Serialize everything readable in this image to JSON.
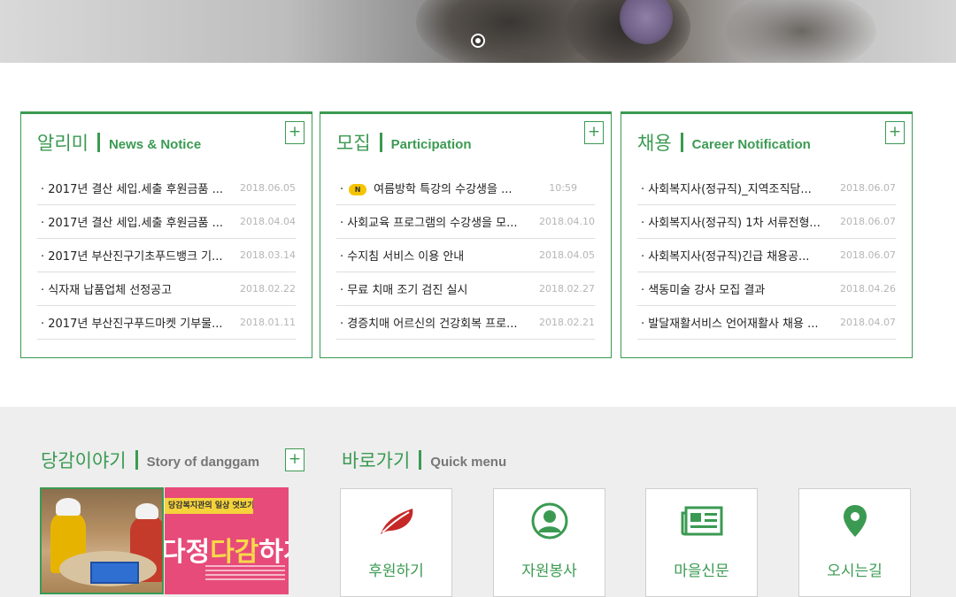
{
  "notice": {
    "title": "알리미",
    "subtitle": "News & Notice",
    "more": "+",
    "items": [
      {
        "title": "2017년 결산 세입.세출 후원금품 ...",
        "date": "2018.06.05"
      },
      {
        "title": "2017년 결산 세입.세출 후원금품 ...",
        "date": "2018.04.04"
      },
      {
        "title": "2017년 부산진구기초푸드뱅크 기...",
        "date": "2018.03.14"
      },
      {
        "title": "식자재 납품업체 선정공고",
        "date": "2018.02.22"
      },
      {
        "title": "2017년 부산진구푸드마켓 기부물...",
        "date": "2018.01.11"
      }
    ]
  },
  "recruit": {
    "title": "모집",
    "subtitle": "Participation",
    "more": "+",
    "badge": "N",
    "items": [
      {
        "title": "여름방학 특강의 수강생을 ...",
        "date": "10:59"
      },
      {
        "title": "사회교육 프로그램의 수강생을 모...",
        "date": "2018.04.10"
      },
      {
        "title": "수지침 서비스 이용 안내",
        "date": "2018.04.05"
      },
      {
        "title": "무료 치매 조기 검진 실시",
        "date": "2018.02.27"
      },
      {
        "title": "경증치매 어르신의 건강회복 프로...",
        "date": "2018.02.21"
      }
    ]
  },
  "career": {
    "title": "채용",
    "subtitle": "Career Notification",
    "more": "+",
    "items": [
      {
        "title": "사회복지사(정규직)_지역조직담...",
        "date": "2018.06.07"
      },
      {
        "title": "사회복지사(정규직) 1차 서류전형...",
        "date": "2018.06.07"
      },
      {
        "title": "사회복지사(정규직)긴급 채용공...",
        "date": "2018.06.07"
      },
      {
        "title": "색동미술 강사 모집 결과",
        "date": "2018.04.26"
      },
      {
        "title": "발달재활서비스 언어재활사 채용 ...",
        "date": "2018.04.07"
      }
    ]
  },
  "story": {
    "title": "당감이야기",
    "subtitle": "Story of danggam",
    "more": "+",
    "image2_banner": "당감복지관의 일상 엿보기",
    "image2_text_a": "다정",
    "image2_text_b": "다감",
    "image2_text_c": "하게"
  },
  "quick": {
    "title": "바로가기",
    "subtitle": "Quick menu",
    "items": [
      {
        "label": "후원하기",
        "icon": "leaf-icon"
      },
      {
        "label": "자원봉사",
        "icon": "user-icon"
      },
      {
        "label": "마을신문",
        "icon": "newspaper-icon"
      },
      {
        "label": "오시는길",
        "icon": "map-pin-icon"
      }
    ]
  },
  "colors": {
    "accent": "#3b9a52",
    "leaf": "#c62828",
    "badge": "#f5c400",
    "date": "#b5b5b5"
  }
}
